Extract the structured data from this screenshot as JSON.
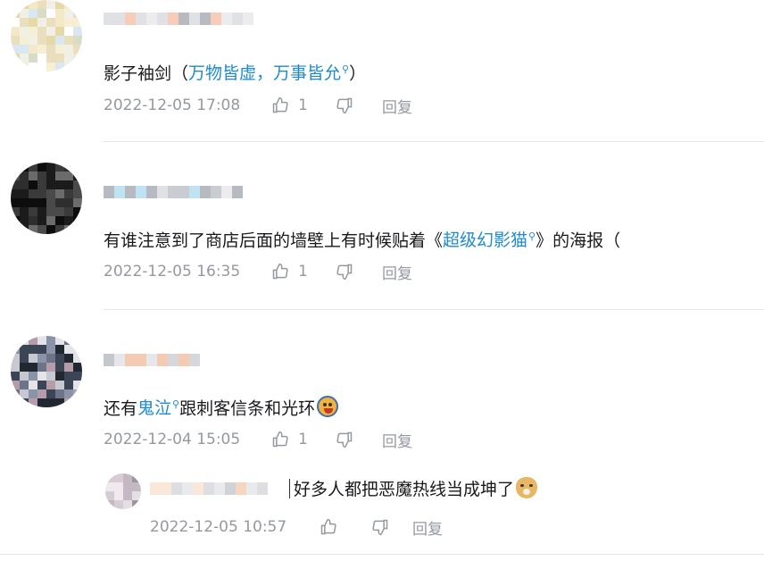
{
  "colors": {
    "link": "#1e8ad0",
    "meta_text": "#9499a0",
    "divider": "#e3e5e7"
  },
  "comments": [
    {
      "text_before": "影子袖剑（",
      "link": "万物皆虚，万事皆允",
      "text_after": "）",
      "time": "2022-12-05 17:08",
      "likes": "1",
      "reply_label": "回复"
    },
    {
      "text_before": "有谁注意到了商店后面的墙壁上有时候贴着《",
      "link": "超级幻影猫",
      "text_after": "》的海报（",
      "time": "2022-12-05 16:35",
      "likes": "1",
      "reply_label": "回复"
    },
    {
      "text_before": "还有",
      "link": "鬼泣",
      "text_after": "跟刺客信条和光环",
      "emoji": "crying-emoji",
      "time": "2022-12-04 15:05",
      "likes": "1",
      "reply_label": "回复"
    }
  ],
  "sub_reply": {
    "text": "好多人都把恶魔热线当成坤了",
    "emoji": "doge-emoji",
    "time": "2022-12-05 10:57",
    "reply_label": "回复"
  },
  "icons": {
    "like": "thumbs-up-icon",
    "dislike": "thumbs-down-icon",
    "search": "search-icon"
  }
}
